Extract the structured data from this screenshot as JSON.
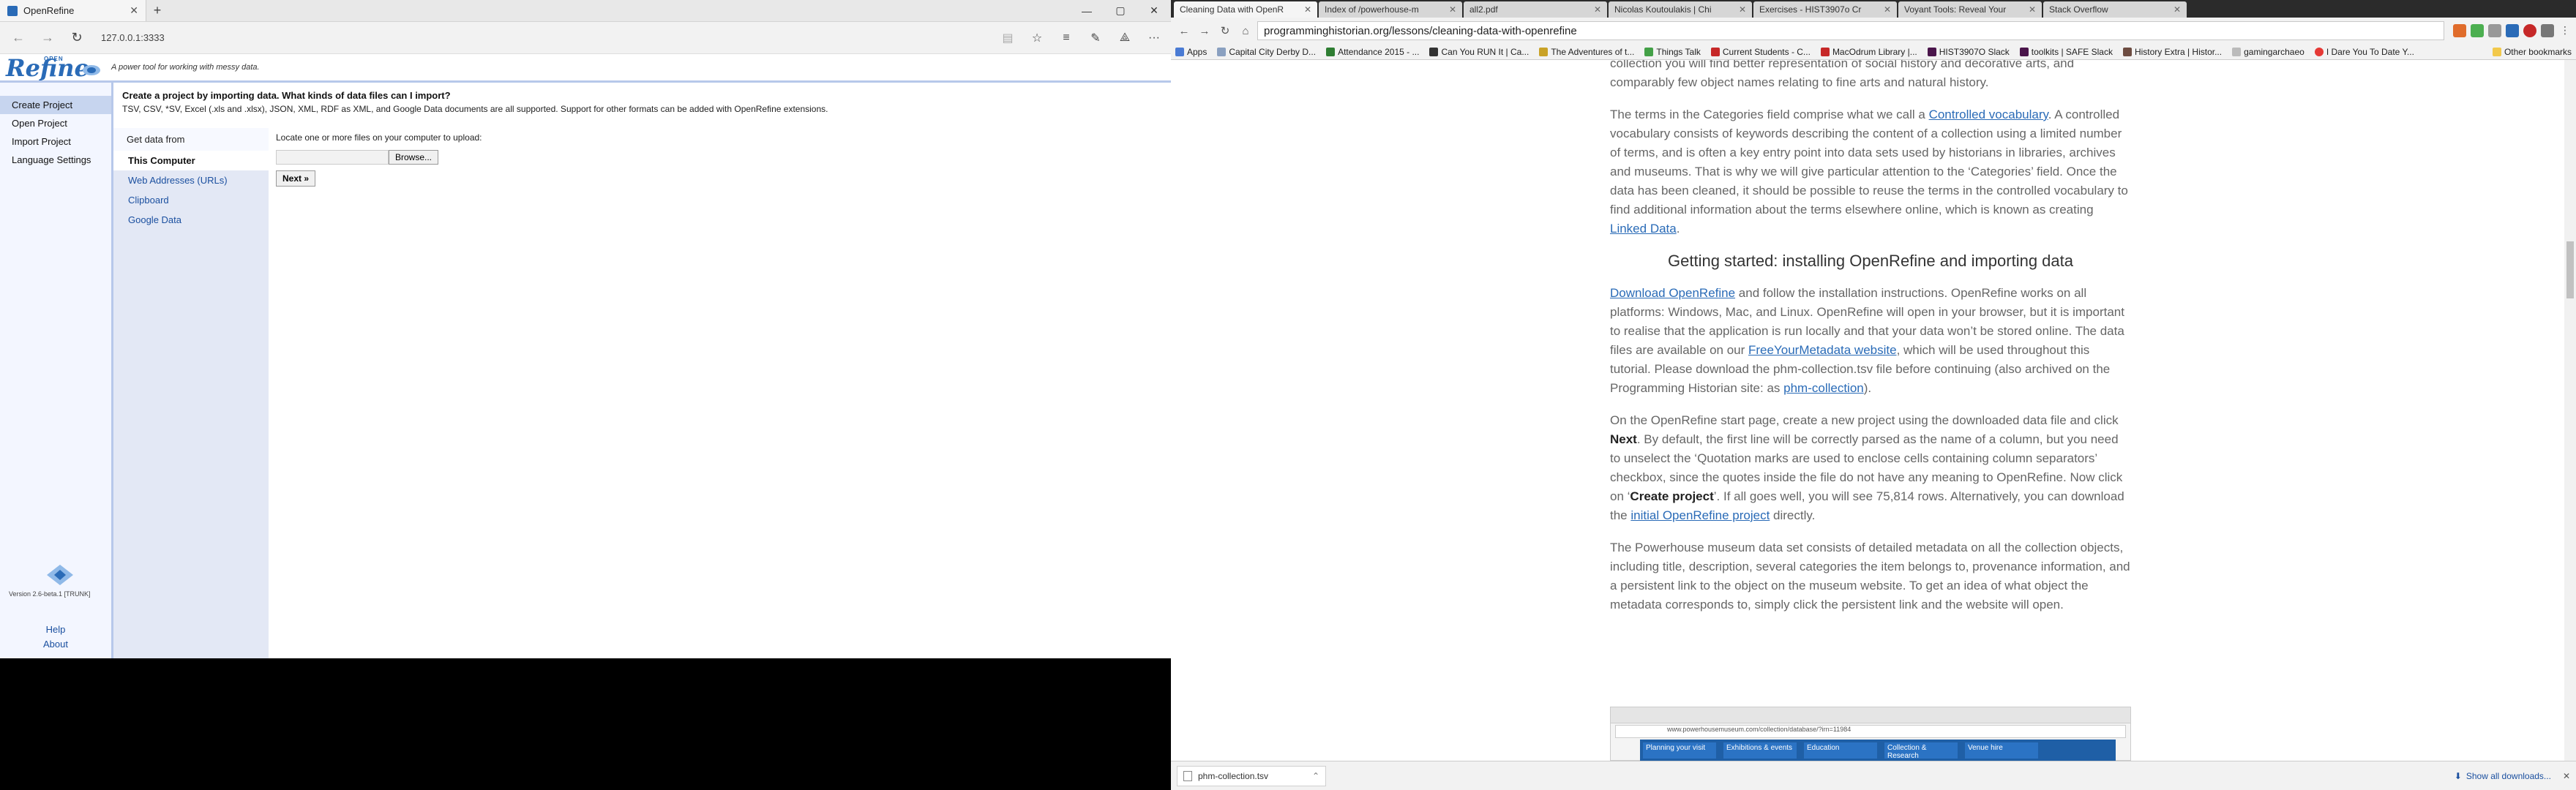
{
  "edge": {
    "tab_title": "OpenRefine",
    "url": "127.0.0.1:3333",
    "tagline": "A power tool for working with messy data.",
    "logo_text": "Refine",
    "logo_small": "OPEN"
  },
  "openrefine": {
    "nav": [
      "Create Project",
      "Open Project",
      "Import Project",
      "Language Settings"
    ],
    "heading": "Create a project by importing data. What kinds of data files can I import?",
    "formats": "TSV, CSV, *SV, Excel (.xls and .xlsx), JSON, XML, RDF as XML, and Google Data documents are all supported. Support for other formats can be added with OpenRefine extensions.",
    "sources_header": "Get data from",
    "sources": [
      "This Computer",
      "Web Addresses (URLs)",
      "Clipboard",
      "Google Data"
    ],
    "upload_label": "Locate one or more files on your computer to upload:",
    "browse": "Browse...",
    "next": "Next »",
    "version": "Version 2.6-beta.1 [TRUNK]",
    "help": "Help",
    "about": "About"
  },
  "chrome": {
    "tabs": [
      "Cleaning Data with OpenR",
      "Index of /powerhouse-m",
      "all2.pdf",
      "Nicolas Koutoulakis | Chi",
      "Exercises - HIST3907o Cr",
      "Voyant Tools: Reveal Your",
      "Stack Overflow"
    ],
    "url": "programminghistorian.org/lessons/cleaning-data-with-openrefine",
    "bookmarks": [
      "Apps",
      "Capital City Derby D...",
      "Attendance 2015 - ...",
      "Can You RUN It | Ca...",
      "The Adventures of t...",
      "Things Talk",
      "Current Students - C...",
      "MacOdrum Library |...",
      "HIST3907O Slack",
      "toolkits | SAFE Slack",
      "History Extra | Histor...",
      "gamingarchaeo",
      "I Dare You To Date Y..."
    ],
    "other_bookmarks": "Other bookmarks",
    "download_file": "phm-collection.tsv",
    "show_downloads": "Show all downloads..."
  },
  "article": {
    "p0": "collection you will find better representation of social history and decorative arts, and comparably few object names relating to fine arts and natural history.",
    "p1_a": "The terms in the Categories field comprise what we call a ",
    "p1_link": "Controlled vocabulary",
    "p1_b": ". A controlled vocabulary consists of keywords describing the content of a collection using a limited number of terms, and is often a key entry point into data sets used by historians in libraries, archives and museums. That is why we will give particular attention to the ‘Categories’ field. Once the data has been cleaned, it should be possible to reuse the terms in the controlled vocabulary to find additional information about the terms elsewhere online, which is known as creating ",
    "p1_link2": "Linked Data",
    "p1_c": ".",
    "h2": "Getting started: installing OpenRefine and importing data",
    "p2_link": "Download OpenRefine",
    "p2_a": " and follow the installation instructions. OpenRefine works on all platforms: Windows, Mac, and Linux. OpenRefine will open in your browser, but it is important to realise that the application is run locally and that your data won’t be stored online. The data files are available on our ",
    "p2_link2": "FreeYourMetadata website",
    "p2_b": ", which will be used throughout this tutorial. Please download the phm-collection.tsv file before continuing (also archived on the Programming Historian site: as ",
    "p2_link3": "phm-collection",
    "p2_c": ").",
    "p3_a": "On the OpenRefine start page, create a new project using the downloaded data file and click ",
    "p3_next": "Next",
    "p3_b": ". By default, the first line will be correctly parsed as the name of a column, but you need to unselect the ‘Quotation marks are used to enclose cells containing column separators’ checkbox, since the quotes inside the file do not have any meaning to OpenRefine. Now click on ‘",
    "p3_create": "Create project",
    "p3_c": "’. If all goes well, you will see 75,814 rows. Alternatively, you can download the ",
    "p3_link": "initial OpenRefine project",
    "p3_d": " directly.",
    "p4": "The Powerhouse museum data set consists of detailed metadata on all the collection objects, including title, description, several categories the item belongs to, provenance information, and a persistent link to the object on the museum website. To get an idea of what object the metadata corresponds to, simply click the persistent link and the website will open.",
    "shot_url": "www.powerhousemuseum.com/collection/database/?irn=11984",
    "shot_nav": [
      "Planning your visit",
      "Exhibitions & events",
      "Education",
      "Collection & Research",
      "Venue hire"
    ]
  }
}
